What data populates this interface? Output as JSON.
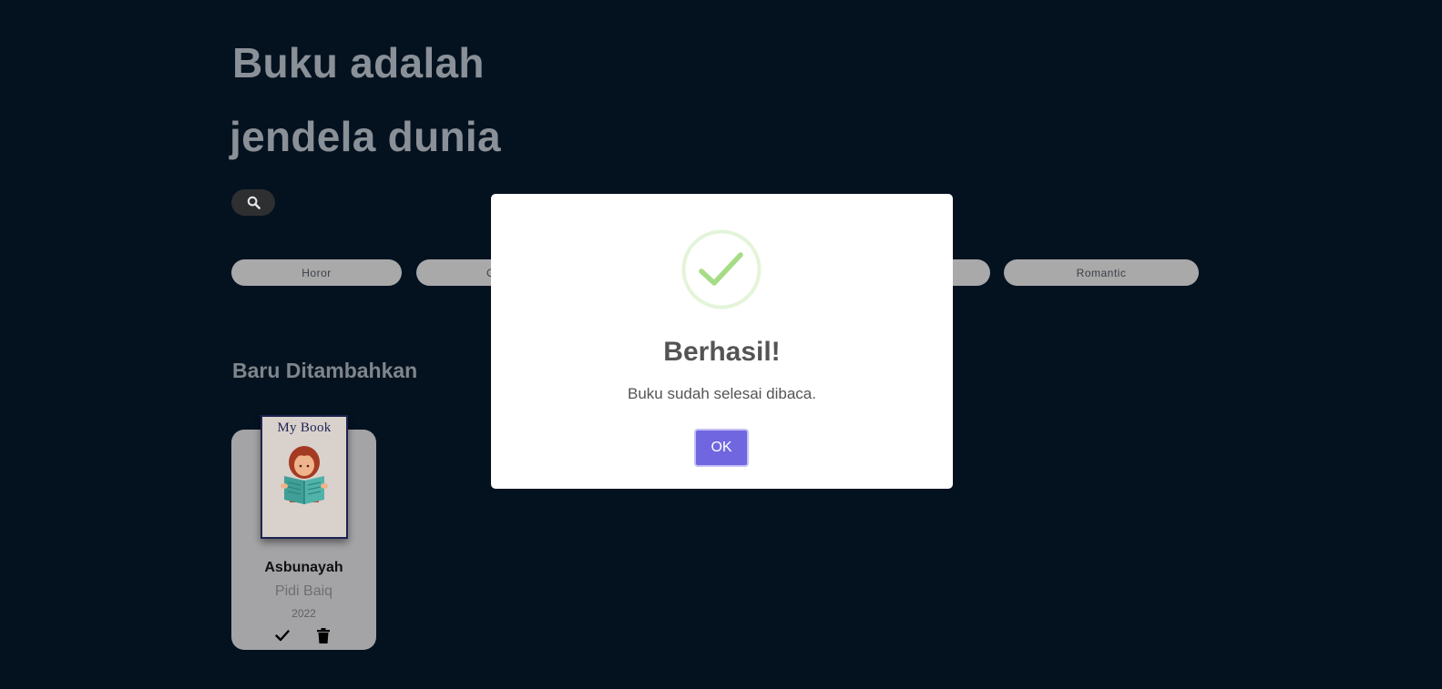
{
  "hero": {
    "line1": "Buku adalah",
    "line2": "jendela dunia"
  },
  "search": {
    "icon": "search-icon"
  },
  "categories": [
    {
      "label": "Horor"
    },
    {
      "label": "C"
    },
    {
      "label": "Romantic"
    }
  ],
  "section": {
    "title": "Baru Ditambahkan"
  },
  "books": [
    {
      "cover_title": "My Book",
      "title": "Asbunayah",
      "author": "Pidi Baiq",
      "year": "2022",
      "actions": {
        "done_icon": "check-icon",
        "delete_icon": "trash-icon"
      }
    }
  ],
  "modal": {
    "icon": "success-check-icon",
    "title": "Berhasil!",
    "text": "Buku sudah selesai dibaca.",
    "ok_label": "OK",
    "ok_color": "#7066e0"
  }
}
